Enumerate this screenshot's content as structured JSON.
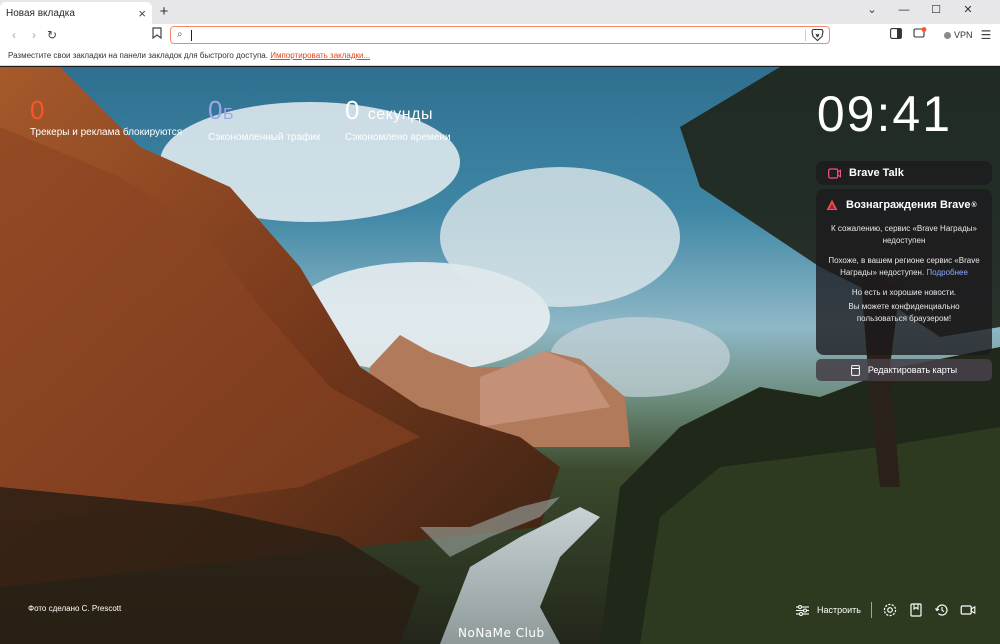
{
  "tab": {
    "title": "Новая вкладка",
    "close_symbol": "×",
    "new_symbol": "+"
  },
  "window_controls": {
    "minimize": "—",
    "maximize": "☐",
    "close": "✕"
  },
  "address_bar": {
    "value": "",
    "placeholder": ""
  },
  "vpn_label": "VPN",
  "bookmarks_bar": {
    "message": "Разместите свои закладки на панели закладок для быстрого доступа.",
    "import_link": "Импортировать закладки..."
  },
  "stats": [
    {
      "value": "0",
      "unit": "",
      "label": "Трекеры и реклама блокируются",
      "color": "#fb542b"
    },
    {
      "value": "0",
      "unit": "Б",
      "label": "Сэкономленный трафик",
      "color": "#a0a5eb"
    },
    {
      "value": "0",
      "unit": "секунды",
      "label": "Сэкономлено времени",
      "color": "#ffffff"
    }
  ],
  "clock": "09:41",
  "widgets": {
    "brave_talk": {
      "title": "Brave Talk"
    },
    "rewards": {
      "title": "Вознаграждения Brave",
      "superscript": "®",
      "msg1": "К сожалению, сервис «Brave Награды» недоступен",
      "msg2": "Похоже, в вашем регионе сервис «Brave Награды» недоступен.",
      "more_link": "Подробнее",
      "msg3": "Но есть и хорошие новости.",
      "msg4": "Вы можете конфиденциально пользоваться браузером!"
    },
    "edit_cards": "Редактировать карты"
  },
  "photo_credit": "Фото сделано C. Prescott",
  "customize_label": "Настроить",
  "watermark": "NoNaMe Club",
  "colors": {
    "brand_orange": "#fb542b",
    "accent_link": "#e0431d",
    "talk_icon": "#ff4d7e"
  }
}
